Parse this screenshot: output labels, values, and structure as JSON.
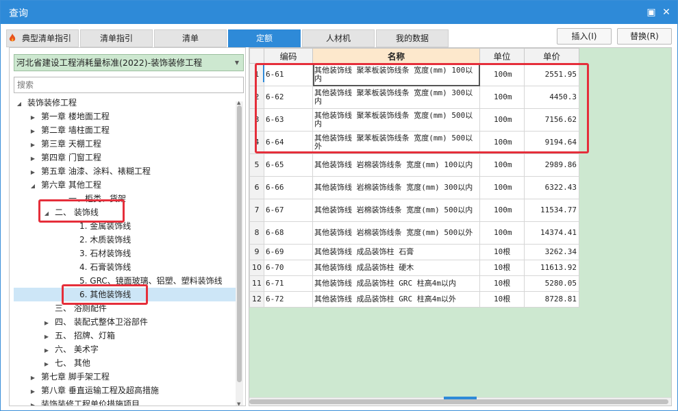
{
  "window": {
    "title": "查询",
    "restore_label": "▣",
    "close_label": "✕"
  },
  "tabs": [
    {
      "label": "典型清单指引"
    },
    {
      "label": "清单指引"
    },
    {
      "label": "清单"
    },
    {
      "label": "定额"
    },
    {
      "label": "人材机"
    },
    {
      "label": "我的数据"
    }
  ],
  "active_tab": "定额",
  "buttons": {
    "insert": "插入(I)",
    "replace": "替换(R)"
  },
  "library_select": {
    "value": "河北省建设工程消耗量标准(2022)-装饰装修工程"
  },
  "search": {
    "placeholder": "搜索",
    "value": ""
  },
  "tree": [
    {
      "label": "装饰装修工程",
      "toggle": "◢"
    },
    {
      "label": "第一章 楼地面工程",
      "toggle": "▶"
    },
    {
      "label": "第二章 墙柱面工程",
      "toggle": "▶"
    },
    {
      "label": "第三章 天棚工程",
      "toggle": "▶"
    },
    {
      "label": "第四章 门窗工程",
      "toggle": "▶"
    },
    {
      "label": "第五章 油漆、涂料、裱糊工程",
      "toggle": "▶"
    },
    {
      "label": "第六章 其他工程",
      "toggle": "◢"
    },
    {
      "label": "一、柜类、货架",
      "toggle": ""
    },
    {
      "label": "二、 装饰线",
      "toggle": "◢"
    },
    {
      "label": "1. 金属装饰线",
      "toggle": ""
    },
    {
      "label": "2. 木质装饰线",
      "toggle": ""
    },
    {
      "label": "3. 石材装饰线",
      "toggle": ""
    },
    {
      "label": "4. 石膏装饰线",
      "toggle": ""
    },
    {
      "label": "5. GRC、镜面玻璃、铝塑、塑料装饰线",
      "toggle": ""
    },
    {
      "label": "6. 其他装饰线",
      "toggle": ""
    },
    {
      "label": "三、 浴厕配件",
      "toggle": ""
    },
    {
      "label": "四、 装配式整体卫浴部件",
      "toggle": "▶"
    },
    {
      "label": "五、 招牌、灯箱",
      "toggle": "▶"
    },
    {
      "label": "六、 美术字",
      "toggle": "▶"
    },
    {
      "label": "七、 其他",
      "toggle": "▶"
    },
    {
      "label": "第七章 脚手架工程",
      "toggle": "▶"
    },
    {
      "label": "第八章 垂直运输工程及超高措施",
      "toggle": "▶"
    },
    {
      "label": "装饰装修工程单价措施项目",
      "toggle": "▶"
    }
  ],
  "selected_node": "6. 其他装饰线",
  "grid": {
    "headers": {
      "code": "编码",
      "name": "名称",
      "unit": "单位",
      "price": "单价"
    },
    "rows": [
      {
        "no": "1",
        "code": "6-61",
        "name": "其他装饰线 聚苯板装饰线条 宽度(mm) 100以内",
        "unit": "100m",
        "price": "2551.95"
      },
      {
        "no": "2",
        "code": "6-62",
        "name": "其他装饰线 聚苯板装饰线条 宽度(mm) 300以内",
        "unit": "100m",
        "price": "4450.3"
      },
      {
        "no": "3",
        "code": "6-63",
        "name": "其他装饰线 聚苯板装饰线条 宽度(mm) 500以内",
        "unit": "100m",
        "price": "7156.62"
      },
      {
        "no": "4",
        "code": "6-64",
        "name": "其他装饰线 聚苯板装饰线条 宽度(mm) 500以外",
        "unit": "100m",
        "price": "9194.64"
      },
      {
        "no": "5",
        "code": "6-65",
        "name": "其他装饰线 岩棉装饰线条 宽度(mm) 100以内",
        "unit": "100m",
        "price": "2989.86"
      },
      {
        "no": "6",
        "code": "6-66",
        "name": "其他装饰线 岩棉装饰线条 宽度(mm) 300以内",
        "unit": "100m",
        "price": "6322.43"
      },
      {
        "no": "7",
        "code": "6-67",
        "name": "其他装饰线 岩棉装饰线条 宽度(mm) 500以内",
        "unit": "100m",
        "price": "11534.77"
      },
      {
        "no": "8",
        "code": "6-68",
        "name": "其他装饰线 岩棉装饰线条 宽度(mm) 500以外",
        "unit": "100m",
        "price": "14374.41"
      },
      {
        "no": "9",
        "code": "6-69",
        "name": "其他装饰线 成品装饰柱 石膏",
        "unit": "10根",
        "price": "3262.34"
      },
      {
        "no": "10",
        "code": "6-70",
        "name": "其他装饰线 成品装饰柱 硬木",
        "unit": "10根",
        "price": "11613.92"
      },
      {
        "no": "11",
        "code": "6-71",
        "name": "其他装饰线 成品装饰柱 GRC 柱高4m以内",
        "unit": "10根",
        "price": "5280.05"
      },
      {
        "no": "12",
        "code": "6-72",
        "name": "其他装饰线 成品装饰柱 GRC 柱高4m以外",
        "unit": "10根",
        "price": "8728.81"
      }
    ]
  },
  "colors": {
    "accent": "#2e8ad8",
    "highlight_box": "#e52e3a",
    "empty_area": "#cde8d0",
    "name_header": "#fde8cc"
  }
}
